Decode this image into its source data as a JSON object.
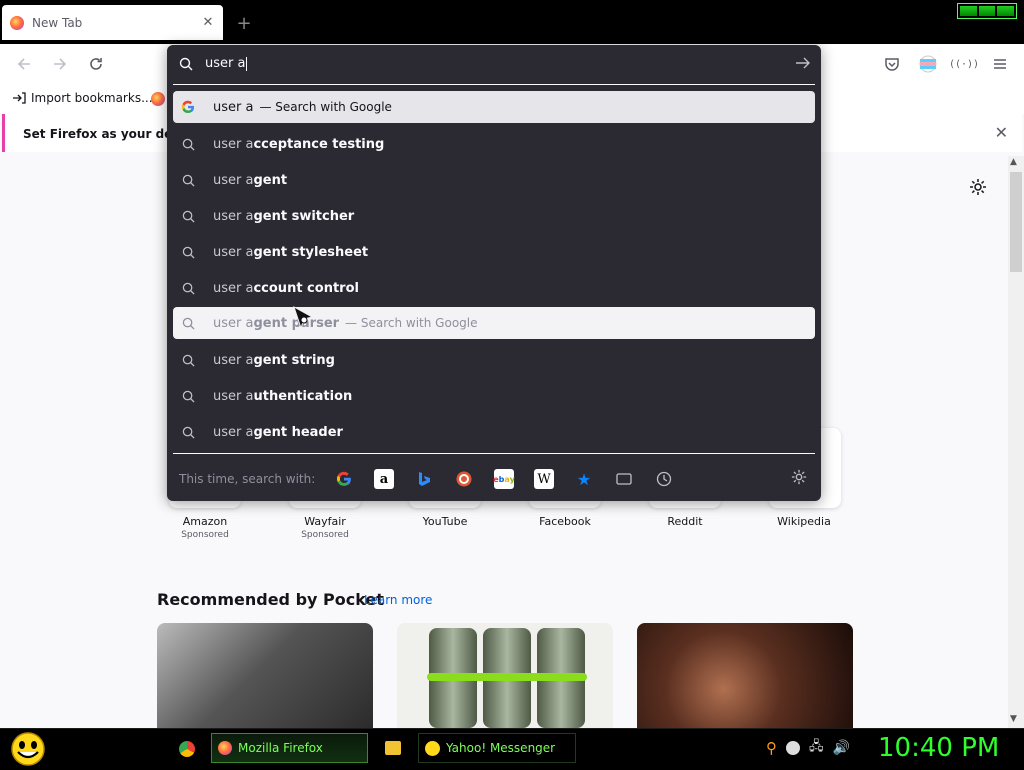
{
  "tabs": [
    {
      "title": "New Tab"
    }
  ],
  "toolbar": {},
  "bookmarks": {
    "import_label": "Import bookmarks..."
  },
  "notification": {
    "text": "Set Firefox as your default"
  },
  "urlbar": {
    "value": "user a",
    "suggestions": [
      {
        "typed": "user a",
        "rest": "",
        "action": "— Search with Google",
        "state": "selected",
        "icon": "google-icon"
      },
      {
        "typed": "user a",
        "rest": "cceptance testing",
        "action": "",
        "state": "normal",
        "icon": "search-icon"
      },
      {
        "typed": "user a",
        "rest": "gent",
        "action": "",
        "state": "normal",
        "icon": "search-icon"
      },
      {
        "typed": "user a",
        "rest": "gent switcher",
        "action": "",
        "state": "normal",
        "icon": "search-icon"
      },
      {
        "typed": "user a",
        "rest": "gent stylesheet",
        "action": "",
        "state": "normal",
        "icon": "search-icon"
      },
      {
        "typed": "user a",
        "rest": "ccount control",
        "action": "",
        "state": "normal",
        "icon": "search-icon"
      },
      {
        "typed": "user a",
        "rest": "gent parser",
        "action": "— Search with Google",
        "state": "hover",
        "icon": "search-icon"
      },
      {
        "typed": "user a",
        "rest": "gent string",
        "action": "",
        "state": "normal",
        "icon": "search-icon"
      },
      {
        "typed": "user a",
        "rest": "uthentication",
        "action": "",
        "state": "normal",
        "icon": "search-icon"
      },
      {
        "typed": "user a",
        "rest": "gent header",
        "action": "",
        "state": "normal",
        "icon": "search-icon"
      }
    ],
    "one_off_label": "This time, search with:",
    "engines": [
      "google-icon",
      "amazon-icon",
      "bing-icon",
      "duckduckgo-icon",
      "ebay-icon",
      "wikipedia-icon",
      "bookmarks-icon",
      "tabs-icon",
      "history-icon"
    ]
  },
  "top_sites": [
    {
      "name": "Amazon",
      "sponsored": "Sponsored"
    },
    {
      "name": "Wayfair",
      "sponsored": "Sponsored"
    },
    {
      "name": "YouTube",
      "sponsored": ""
    },
    {
      "name": "Facebook",
      "sponsored": ""
    },
    {
      "name": "Reddit",
      "sponsored": ""
    },
    {
      "name": "Wikipedia",
      "sponsored": ""
    }
  ],
  "pocket": {
    "title": "Recommended by Pocket",
    "learn_more": "Learn more"
  },
  "taskbar": {
    "items": [
      {
        "label": "Mozilla Firefox",
        "icon": "firefox-icon"
      },
      {
        "label": "Yahoo! Messenger",
        "icon": "yahoo-messenger-icon"
      }
    ],
    "clock": "10:40 PM"
  },
  "colors": {
    "accent": "#0061e0",
    "urlbar_bg": "#2b2a33",
    "notif_accent": "#e83ea8",
    "clock": "#2dff2d"
  }
}
